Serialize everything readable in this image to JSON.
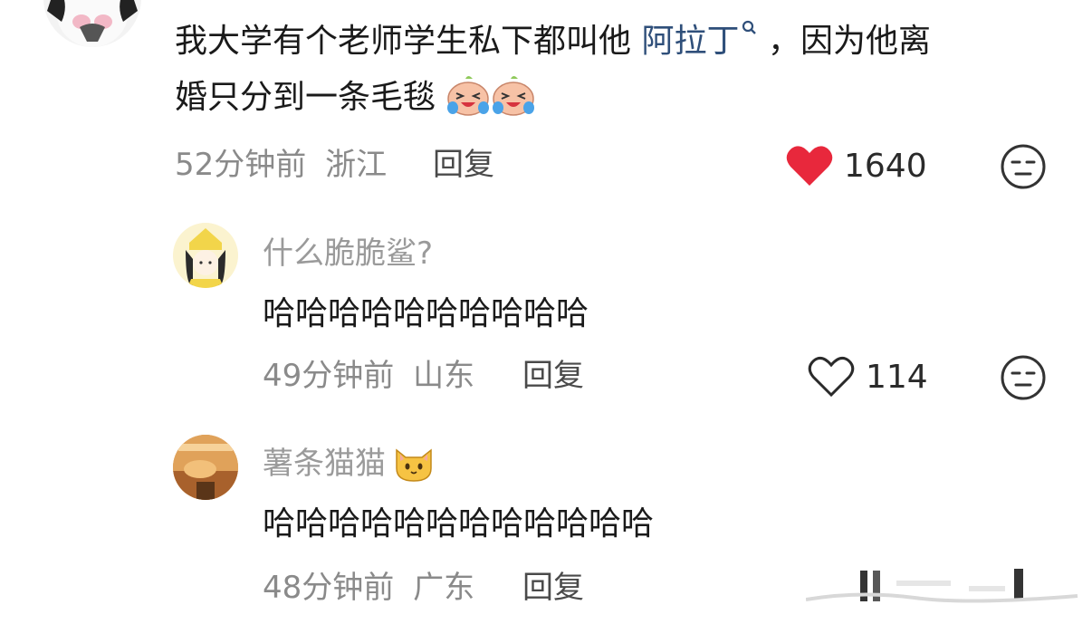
{
  "comment_main": {
    "text_before": "我大学有个老师学生私下都叫他",
    "link_text": "阿拉丁",
    "text_after_line1": "，因为他离",
    "line2_text": "婚只分到一条毛毯",
    "time": "52分钟前",
    "location": "浙江",
    "reply_label": "回复",
    "like_count": "1640",
    "liked": true
  },
  "replies": [
    {
      "username": "什么脆脆鲨?",
      "text": "哈哈哈哈哈哈哈哈哈哈",
      "time": "49分钟前",
      "location": "山东",
      "reply_label": "回复",
      "like_count": "114",
      "liked": false
    },
    {
      "username": "薯条猫猫",
      "text": "哈哈哈哈哈哈哈哈哈哈哈哈",
      "time": "48分钟前",
      "location": "广东",
      "reply_label": "回复"
    }
  ],
  "colors": {
    "heart_red": "#e8283c",
    "link_blue": "#2f4f7a"
  },
  "icons": [
    "search-icon",
    "heart-icon",
    "dislike-face-icon",
    "crying-emoji-icon",
    "cat-emoji-icon",
    "weibo-watermark"
  ]
}
